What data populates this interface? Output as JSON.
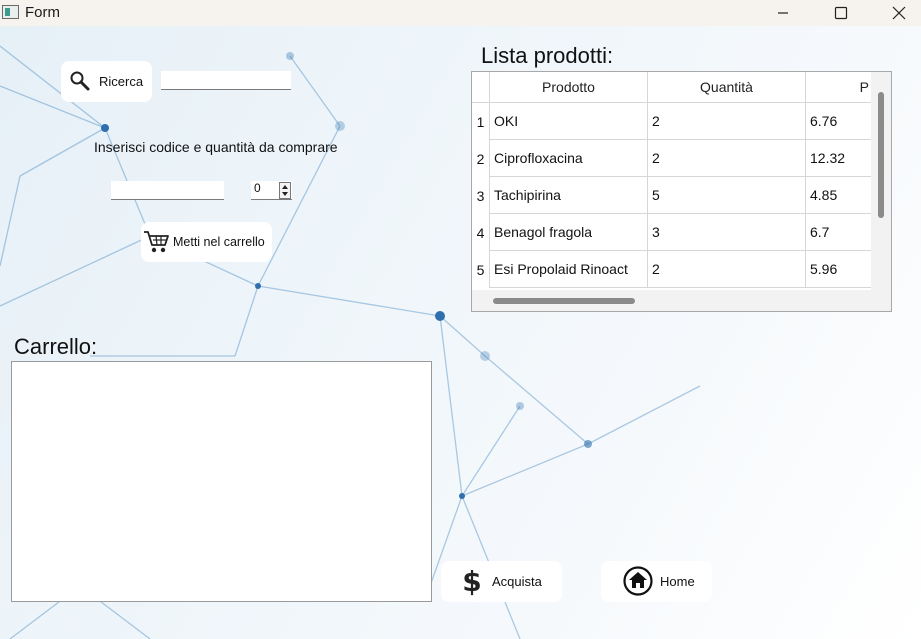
{
  "window": {
    "title": "Form"
  },
  "search": {
    "button_label": "Ricerca",
    "value": ""
  },
  "purchase": {
    "instruction": "Inserisci codice e quantità da comprare",
    "code_value": "",
    "quantity_value": "0",
    "add_to_cart_label": "Metti nel carrello"
  },
  "products": {
    "heading": "Lista prodotti:",
    "columns": [
      "Prodotto",
      "Quantità",
      "P"
    ],
    "rows": [
      {
        "index": "1",
        "name": "OKI",
        "qty": "2",
        "price": "6.76"
      },
      {
        "index": "2",
        "name": "Ciprofloxacina",
        "qty": "2",
        "price": "12.32"
      },
      {
        "index": "3",
        "name": "Tachipirina",
        "qty": "5",
        "price": "4.85"
      },
      {
        "index": "4",
        "name": "Benagol fragola",
        "qty": "3",
        "price": "6.7"
      },
      {
        "index": "5",
        "name": "Esi Propolaid Rinoact",
        "qty": "2",
        "price": "5.96"
      }
    ]
  },
  "cart": {
    "heading": "Carrello:"
  },
  "actions": {
    "buy_label": "Acquista",
    "home_label": "Home"
  },
  "icons": {
    "search": "magnifier-icon",
    "cart": "shopping-cart-icon",
    "buy": "dollar-icon",
    "home": "home-icon"
  }
}
